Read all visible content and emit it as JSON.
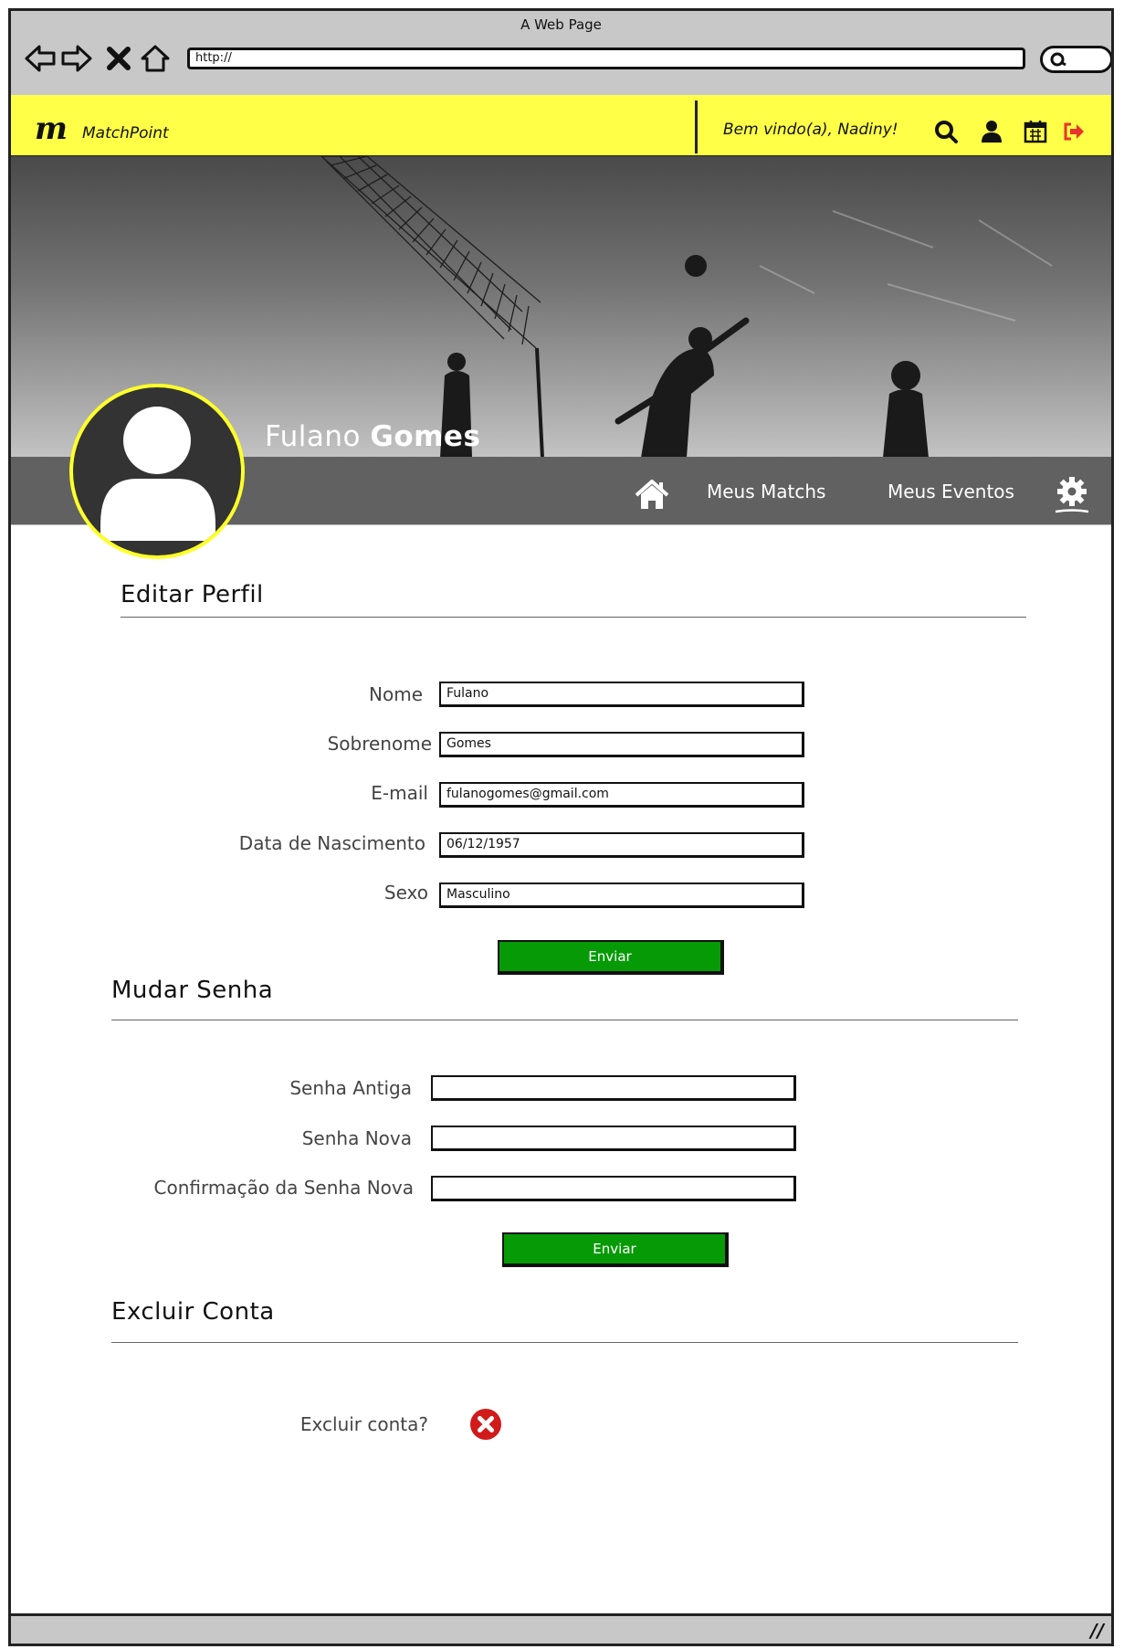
{
  "browser": {
    "window_title": "A Web Page",
    "url": "http://"
  },
  "topbar": {
    "logo_mark": "m",
    "brand": "MatchPoint",
    "welcome": "Bem vindo(a), Nadiny!",
    "icons": [
      "search-icon",
      "user-icon",
      "calendar-icon",
      "logout-icon"
    ],
    "colors": {
      "background": "#ffff47",
      "logout": "#e8342a"
    }
  },
  "profile": {
    "first_name": "Fulano",
    "last_name": "Gomes",
    "nav": {
      "home_icon": "home-icon",
      "matches": "Meus Matchs",
      "events": "Meus Eventos",
      "settings_icon": "gear-icon"
    },
    "colors": {
      "avatar_ring": "#ffff2a",
      "bar": "#616161"
    }
  },
  "edit_profile": {
    "title": "Editar Perfil",
    "fields": [
      {
        "label": "Nome",
        "value": "Fulano"
      },
      {
        "label": "Sobrenome",
        "value": "Gomes"
      },
      {
        "label": "E-mail",
        "value": "fulanogomes@gmail.com"
      },
      {
        "label": "Data de Nascimento",
        "value": "06/12/1957"
      },
      {
        "label": "Sexo",
        "value": "Masculino"
      }
    ],
    "submit": "Enviar"
  },
  "change_password": {
    "title": "Mudar Senha",
    "fields": [
      {
        "label": "Senha Antiga",
        "value": ""
      },
      {
        "label": "Senha Nova",
        "value": ""
      },
      {
        "label": "Confirmação da Senha Nova",
        "value": ""
      }
    ],
    "submit": "Enviar"
  },
  "delete_account": {
    "title": "Excluir Conta",
    "question": "Excluir conta?",
    "icon": "delete-icon",
    "icon_color": "#d11a1a"
  },
  "accent": {
    "button": "#079a07"
  }
}
